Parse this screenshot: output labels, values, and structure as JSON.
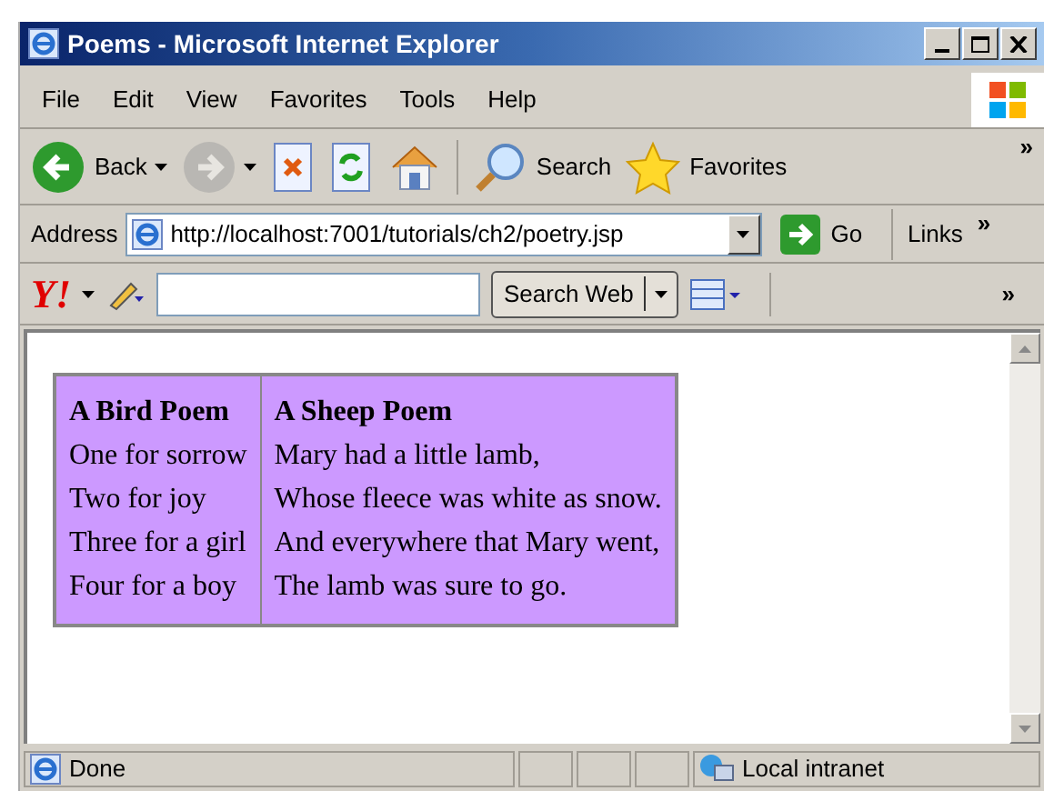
{
  "window": {
    "title": "Poems - Microsoft Internet Explorer"
  },
  "menu": [
    "File",
    "Edit",
    "View",
    "Favorites",
    "Tools",
    "Help"
  ],
  "toolbar": [
    {
      "kind": "back",
      "label": "Back",
      "disabled": false
    },
    {
      "kind": "forward",
      "disabled": true
    },
    {
      "kind": "stop",
      "disabled": false
    },
    {
      "kind": "refresh",
      "disabled": false
    },
    {
      "kind": "home",
      "disabled": false
    },
    {
      "kind": "search",
      "label": "Search",
      "disabled": false
    },
    {
      "kind": "favorites",
      "label": "Favorites",
      "disabled": false
    }
  ],
  "toolbar_more": "»",
  "address_bar": {
    "label": "Address",
    "value": "http://localhost:7001/tutorials/ch2/poetry.jsp",
    "go": "Go",
    "links": "Links",
    "more": "»"
  },
  "yahoo_bar": {
    "logo": "Y!",
    "search_button": "Search Web",
    "more": "»"
  },
  "table": {
    "columns": [
      {
        "heading": "A Bird Poem",
        "lines": [
          "One for sorrow",
          "Two for joy",
          "Three for a girl",
          "Four for a boy"
        ]
      },
      {
        "heading": "A Sheep Poem",
        "lines": [
          "Mary had a little lamb,",
          "Whose fleece was white as snow.",
          "And everywhere that Mary went,",
          "The lamb was sure to go."
        ]
      }
    ]
  },
  "status_bar": {
    "status": "Done",
    "zone": "Local intranet"
  }
}
